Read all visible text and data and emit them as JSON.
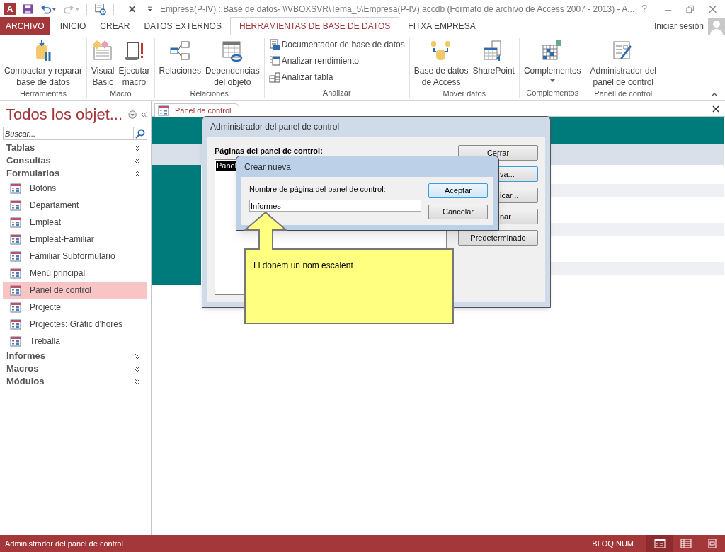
{
  "title_bar": {
    "app_logo": "A",
    "title": "Empresa(P-IV) : Base de datos- \\\\VBOXSVR\\Tema_5\\Empresa(P-IV).accdb (Formato de archivo de Access 2007 - 2013) - A...",
    "help": "?"
  },
  "ribbon_tabs": [
    {
      "label": "ARCHIVO",
      "kind": "file",
      "selected": false
    },
    {
      "label": "INICIO",
      "kind": "tab",
      "selected": false
    },
    {
      "label": "CREAR",
      "kind": "tab",
      "selected": false
    },
    {
      "label": "DATOS EXTERNOS",
      "kind": "tab",
      "selected": false
    },
    {
      "label": "HERRAMIENTAS DE BASE DE DATOS",
      "kind": "tab",
      "selected": true
    },
    {
      "label": "FITXA EMPRESA",
      "kind": "tab",
      "selected": false
    }
  ],
  "account": {
    "label": "Iniciar sesión"
  },
  "ribbon_groups": [
    {
      "label": "Herramientas",
      "buttons": [
        {
          "kind": "large",
          "lines": [
            "Compactar y reparar",
            "base de datos"
          ]
        }
      ]
    },
    {
      "label": "Macro",
      "buttons": [
        {
          "kind": "large",
          "lines": [
            "Visual",
            "Basic"
          ]
        },
        {
          "kind": "large",
          "lines": [
            "Ejecutar",
            "macro"
          ]
        }
      ]
    },
    {
      "label": "Relaciones",
      "buttons": [
        {
          "kind": "large",
          "lines": [
            "Relaciones"
          ]
        },
        {
          "kind": "large",
          "lines": [
            "Dependencias",
            "del objeto"
          ]
        }
      ]
    },
    {
      "label": "Analizar",
      "buttons": [
        {
          "kind": "small",
          "lines": [
            "Documentador de base de datos"
          ]
        },
        {
          "kind": "small",
          "lines": [
            "Analizar rendimiento"
          ]
        },
        {
          "kind": "small",
          "lines": [
            "Analizar tabla"
          ]
        }
      ]
    },
    {
      "label": "Mover datos",
      "buttons": [
        {
          "kind": "large",
          "lines": [
            "Base de datos",
            "de Access"
          ]
        },
        {
          "kind": "large",
          "lines": [
            "SharePoint"
          ]
        }
      ]
    },
    {
      "label": "Complementos",
      "buttons": [
        {
          "kind": "dropdown",
          "lines": [
            "Complementos"
          ]
        }
      ]
    },
    {
      "label": "Panell de control",
      "buttons": [
        {
          "kind": "large",
          "lines": [
            "Administrador del",
            "panel de control"
          ]
        }
      ]
    }
  ],
  "navigation": {
    "title": "Todos los objet...",
    "search": {
      "placeholder": "Buscar..."
    },
    "groups": [
      {
        "label": "Tablas",
        "expanded": false
      },
      {
        "label": "Consultas",
        "expanded": false
      },
      {
        "label": "Formularios",
        "expanded": true,
        "children": [
          {
            "label": "Botons",
            "selected": false
          },
          {
            "label": "Departament",
            "selected": false
          },
          {
            "label": "Empleat",
            "selected": false
          },
          {
            "label": "Empleat-Familiar",
            "selected": false
          },
          {
            "label": "Familiar Subformulario",
            "selected": false
          },
          {
            "label": "Menú principal",
            "selected": false
          },
          {
            "label": "Panel de control",
            "selected": true
          },
          {
            "label": "Projecte",
            "selected": false
          },
          {
            "label": "Projectes: Gràfic d'hores",
            "selected": false
          },
          {
            "label": "Treballa",
            "selected": false
          }
        ]
      },
      {
        "label": "Informes",
        "expanded": false
      },
      {
        "label": "Macros",
        "expanded": false
      },
      {
        "label": "Módulos",
        "expanded": false
      }
    ]
  },
  "document_tab": {
    "label": "Panel de control",
    "selected": true
  },
  "switchboard_dialog": {
    "title": "Administrador del panel de control",
    "list_label": "Páginas del panel de control:",
    "pages": [
      {
        "label": "Panel",
        "selected": true
      }
    ],
    "buttons": [
      {
        "label": "Cerrar",
        "focused": false
      },
      {
        "label": "va...",
        "focused": true
      },
      {
        "label": "icar...",
        "focused": false
      },
      {
        "label": "nar",
        "focused": false
      },
      {
        "label": "Predeterminado",
        "focused": false
      }
    ]
  },
  "new_page_dialog": {
    "title": "Crear nueva",
    "field_label": "Nombre de página del panel de control:",
    "value": "Informes",
    "buttons": [
      {
        "label": "Aceptar",
        "focused": true
      },
      {
        "label": "Cancelar",
        "focused": false
      }
    ]
  },
  "callout": {
    "text": "Li donem un nom escaient"
  },
  "status_bar": {
    "text": "Administrador del panel de control",
    "indicator": "BLOQ NUM",
    "views": [
      {
        "selected": true
      },
      {
        "selected": false
      },
      {
        "selected": false
      }
    ]
  }
}
